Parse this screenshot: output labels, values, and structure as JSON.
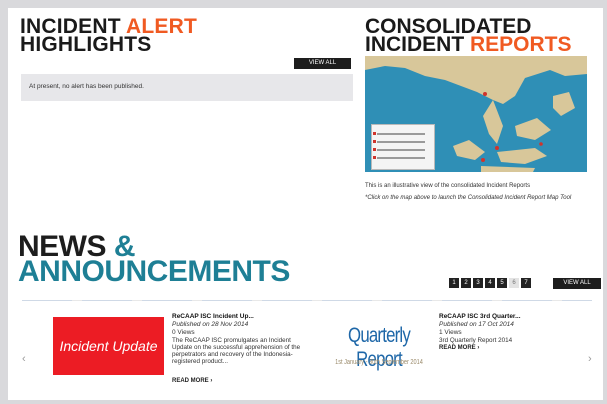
{
  "alert": {
    "title_line1_a": "INCIDENT ",
    "title_line1_b": "ALERT",
    "title_line2": "HIGHLIGHTS",
    "view_all": "VIEW ALL",
    "message": "At present, no alert has been published."
  },
  "reports": {
    "title_line1": "CONSOLIDATED",
    "title_line2_a": "INCIDENT ",
    "title_line2_b": "REPORTS",
    "caption": "This is an illustrative view of the consolidated Incident Reports",
    "hint": "*Click on the map above to launch the Consolidated Incident Report Map Tool"
  },
  "news": {
    "title_line1_a": "NEWS ",
    "title_line1_b": "&",
    "title_line2": "ANNOUNCEMENTS",
    "pages": [
      "1",
      "2",
      "3",
      "4",
      "5",
      "6",
      "7"
    ],
    "active_page": "6",
    "view_all": "VIEW ALL",
    "items": [
      {
        "thumb_text": "Incident Update",
        "title": "ReCAAP ISC Incident Up...",
        "published": "Published on 28 Nov 2014",
        "views": "0 Views",
        "text": "The ReCAAP ISC promulgates an Incident Update on the successful apprehension of the perpetrators and recovery of the Indonesia-registered product...",
        "read_more": "READ MORE ›"
      },
      {
        "thumb_title": "Quarterly Report",
        "thumb_sub": "1st January - 30th September 2014",
        "title": "ReCAAP ISC 3rd Quarter...",
        "published": "Published on 17 Oct 2014",
        "views": "1 Views",
        "text": "3rd Quarterly Report 2014",
        "read_more": "READ MORE ›"
      }
    ]
  },
  "colors": {
    "accent_orange": "#f05a22",
    "accent_teal": "#1e7f95",
    "alert_red": "#ec1c24"
  }
}
